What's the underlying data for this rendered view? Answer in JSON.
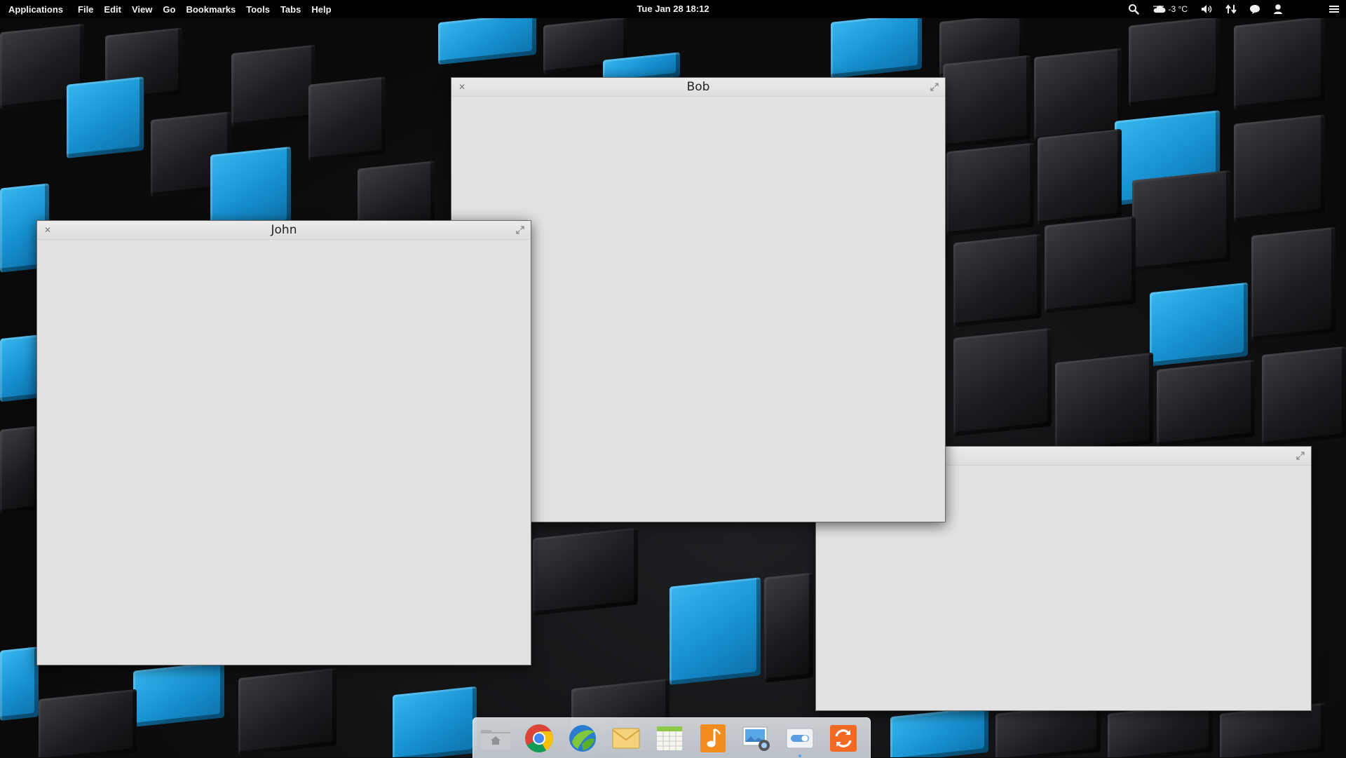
{
  "top_panel": {
    "app_menu": "Applications",
    "menus": [
      "File",
      "Edit",
      "View",
      "Go",
      "Bookmarks",
      "Tools",
      "Tabs",
      "Help"
    ],
    "clock": "Tue Jan 28 18:12",
    "weather": "-3 °C",
    "indicators": [
      "search-icon",
      "weather-icon",
      "volume-icon",
      "network-icon",
      "messaging-icon",
      "user-icon",
      "menu-icon"
    ]
  },
  "windows": [
    {
      "title": "Bob"
    },
    {
      "title": "John"
    },
    {
      "title": ""
    }
  ],
  "dock": {
    "items": [
      "files-icon",
      "chrome-icon",
      "midori-browser-icon",
      "mail-icon",
      "calendar-icon",
      "music-icon",
      "photos-icon",
      "switchboard-settings-icon",
      "software-update-icon"
    ]
  },
  "colors": {
    "wallpaper_blue": "#1a9ad6",
    "wallpaper_dark": "#1c1d20",
    "window_bg": "#e2e2e2",
    "panel_bg": "#000000"
  }
}
